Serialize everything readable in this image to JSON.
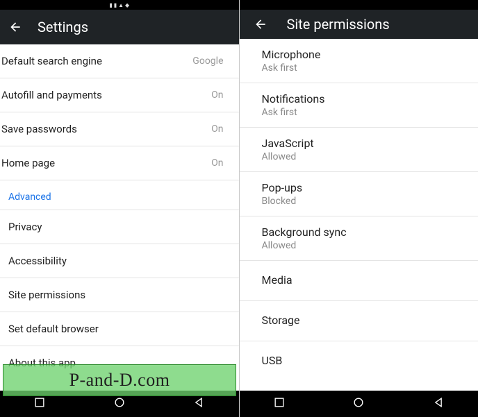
{
  "left": {
    "header_title": "Settings",
    "rows": [
      {
        "label": "Default search engine",
        "value": "Google"
      },
      {
        "label": "Autofill and payments",
        "value": "On"
      },
      {
        "label": "Save passwords",
        "value": "On"
      },
      {
        "label": "Home page",
        "value": "On"
      }
    ],
    "advanced_label": "Advanced",
    "advanced_rows": [
      {
        "label": "Privacy"
      },
      {
        "label": "Accessibility"
      },
      {
        "label": "Site permissions"
      },
      {
        "label": "Set default browser"
      },
      {
        "label": "About this app"
      }
    ]
  },
  "right": {
    "header_title": "Site permissions",
    "permissions": [
      {
        "title": "Microphone",
        "status": "Ask first"
      },
      {
        "title": "Notifications",
        "status": "Ask first"
      },
      {
        "title": "JavaScript",
        "status": "Allowed"
      },
      {
        "title": "Pop-ups",
        "status": "Blocked"
      },
      {
        "title": "Background sync",
        "status": "Allowed"
      },
      {
        "title": "Media",
        "status": ""
      },
      {
        "title": "Storage",
        "status": ""
      },
      {
        "title": "USB",
        "status": ""
      }
    ]
  },
  "watermark": "P-and-D.com"
}
